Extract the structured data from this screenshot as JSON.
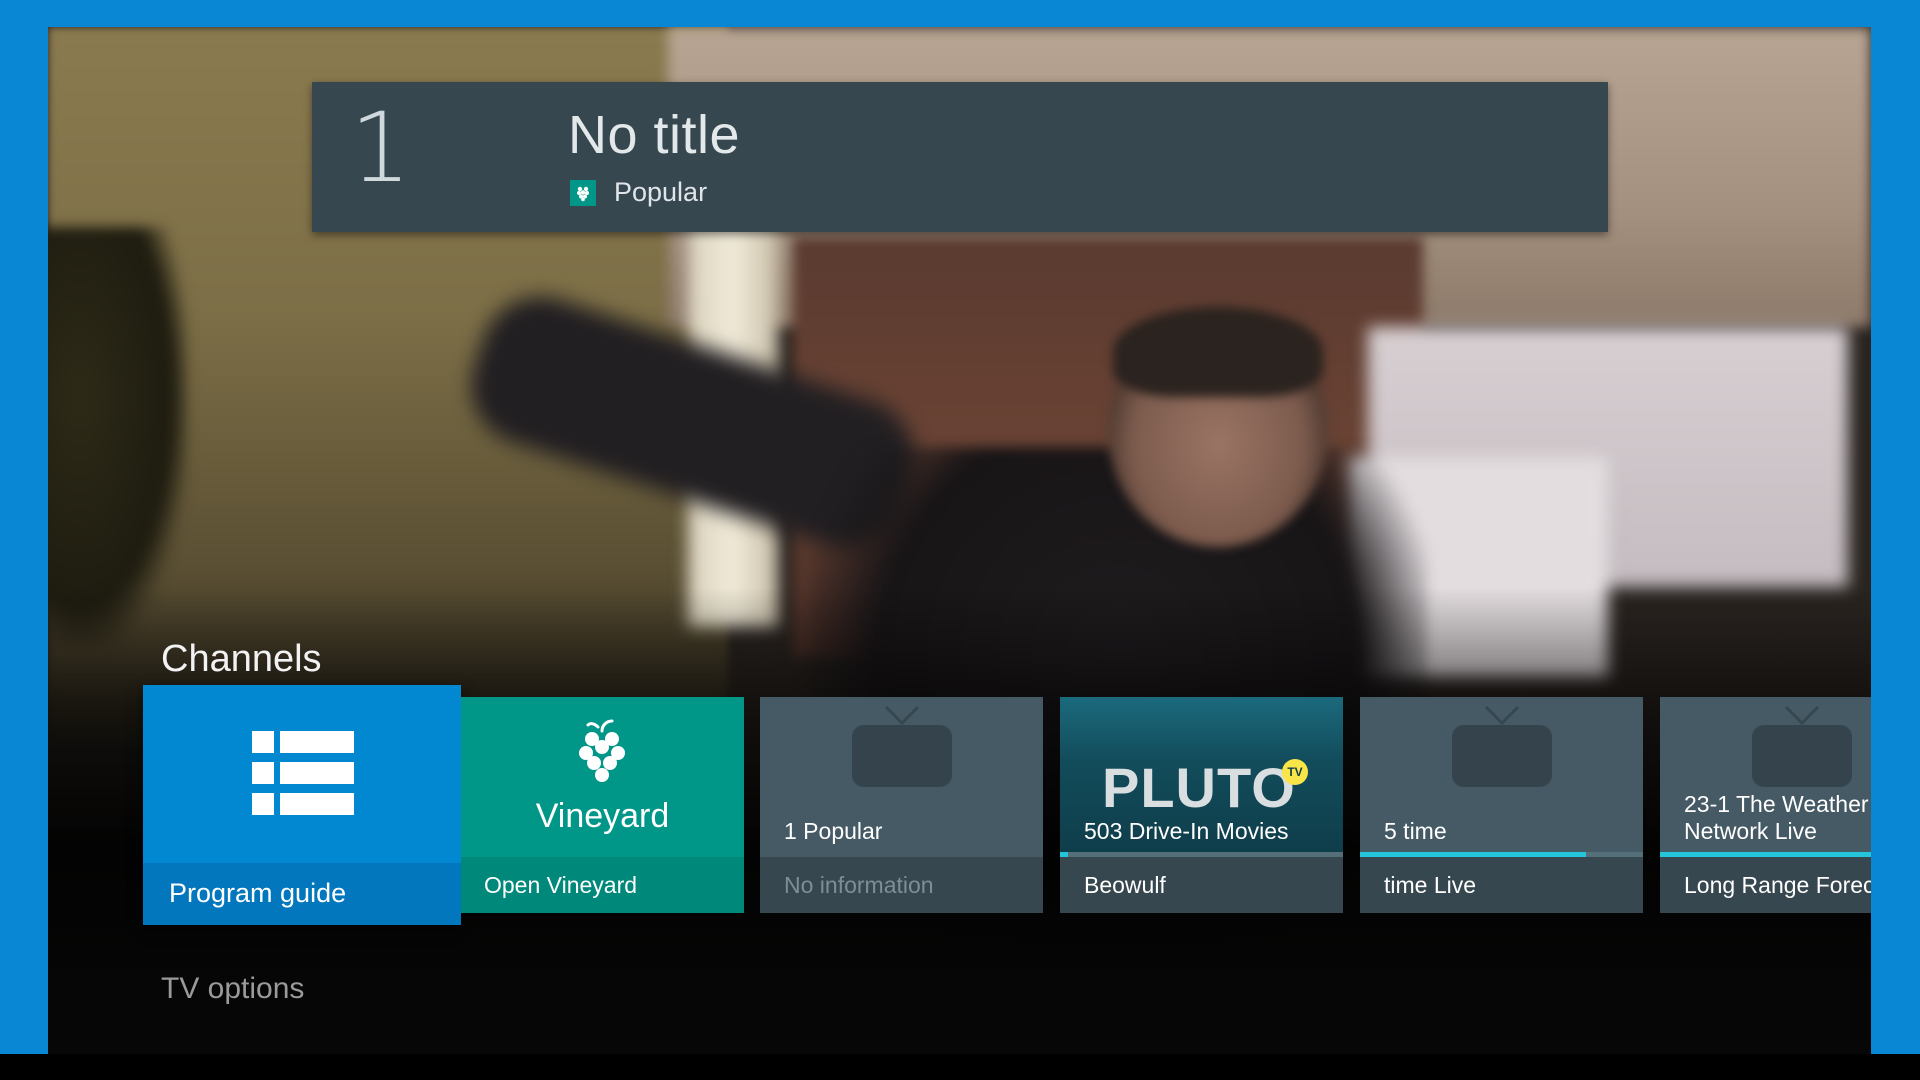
{
  "info_banner": {
    "channel_number": "1",
    "program_title": "No title",
    "source_name": "Popular",
    "source_icon": "vineyard-grape-icon"
  },
  "channels_section": {
    "title": "Channels",
    "program_guide": {
      "label": "Program guide",
      "icon": "list-icon"
    },
    "vineyard": {
      "brand": "Vineyard",
      "action": "Open Vineyard",
      "icon": "grape-icon"
    },
    "cards": [
      {
        "channel": "1 Popular",
        "program": "No information",
        "icon": "tv-icon"
      },
      {
        "channel": "503 Drive-In Movies",
        "program": "Beowulf",
        "logo": "PLUTO",
        "logo_badge": "TV",
        "progress": 0.03
      },
      {
        "channel": "5 time",
        "program": "time Live",
        "icon": "tv-icon",
        "progress": 0.8
      },
      {
        "channel_line1": "23-1 The Weather",
        "channel_line2": "Network Live",
        "program": "Long Range Forecas",
        "icon": "tv-icon",
        "progress": 1.0
      }
    ]
  },
  "tv_options": {
    "title": "TV options"
  },
  "colors": {
    "frame": "#0a87d4",
    "banner": "#37474f",
    "guide_card": "#0288d1",
    "vineyard_card": "#009688",
    "channel_card": "#455a64",
    "progress": "#26c6da"
  }
}
